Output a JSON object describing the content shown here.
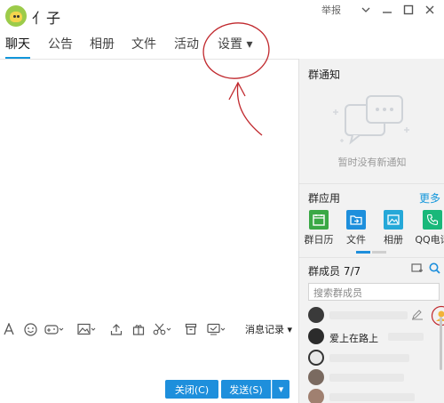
{
  "window": {
    "group_name": "亻子",
    "report_label": "举报",
    "minimize_icon": "minimize-icon",
    "maximize_icon": "maximize-icon",
    "close_icon": "close-icon"
  },
  "tabs": [
    {
      "label": "聊天",
      "active": true
    },
    {
      "label": "公告",
      "active": false
    },
    {
      "label": "相册",
      "active": false
    },
    {
      "label": "文件",
      "active": false
    },
    {
      "label": "活动",
      "active": false
    },
    {
      "label": "设置 ▾",
      "active": false
    }
  ],
  "toolbar": {
    "history_label": "消息记录 ▾",
    "icons": [
      "font-icon",
      "emoji-icon",
      "gamepad-icon",
      "image-icon",
      "upload-icon",
      "gift-icon",
      "scissors-icon",
      "archive-icon",
      "screen-icon"
    ]
  },
  "buttons": {
    "close_label": "关闭(C)",
    "send_label": "发送(S)",
    "send_dropdown": "▾"
  },
  "right_panel": {
    "notice": {
      "title": "群通知",
      "empty_text": "暂时没有新通知"
    },
    "apps": {
      "title": "群应用",
      "more_label": "更多",
      "items": [
        {
          "label": "群日历",
          "icon": "calendar-icon",
          "color": "#3aa845"
        },
        {
          "label": "文件",
          "icon": "folder-icon",
          "color": "#1e8fdc"
        },
        {
          "label": "相册",
          "icon": "photo-icon",
          "color": "#25a8d8"
        },
        {
          "label": "QQ电话",
          "icon": "phone-icon",
          "color": "#19b87a"
        }
      ]
    },
    "members": {
      "title": "群成员 7/7",
      "search_placeholder": "搜索群成员",
      "list": [
        {
          "name": "爱上在路上"
        }
      ]
    }
  },
  "colors": {
    "accent": "#1296db",
    "button": "#1e8fdc",
    "annotation": "#c0282d"
  }
}
